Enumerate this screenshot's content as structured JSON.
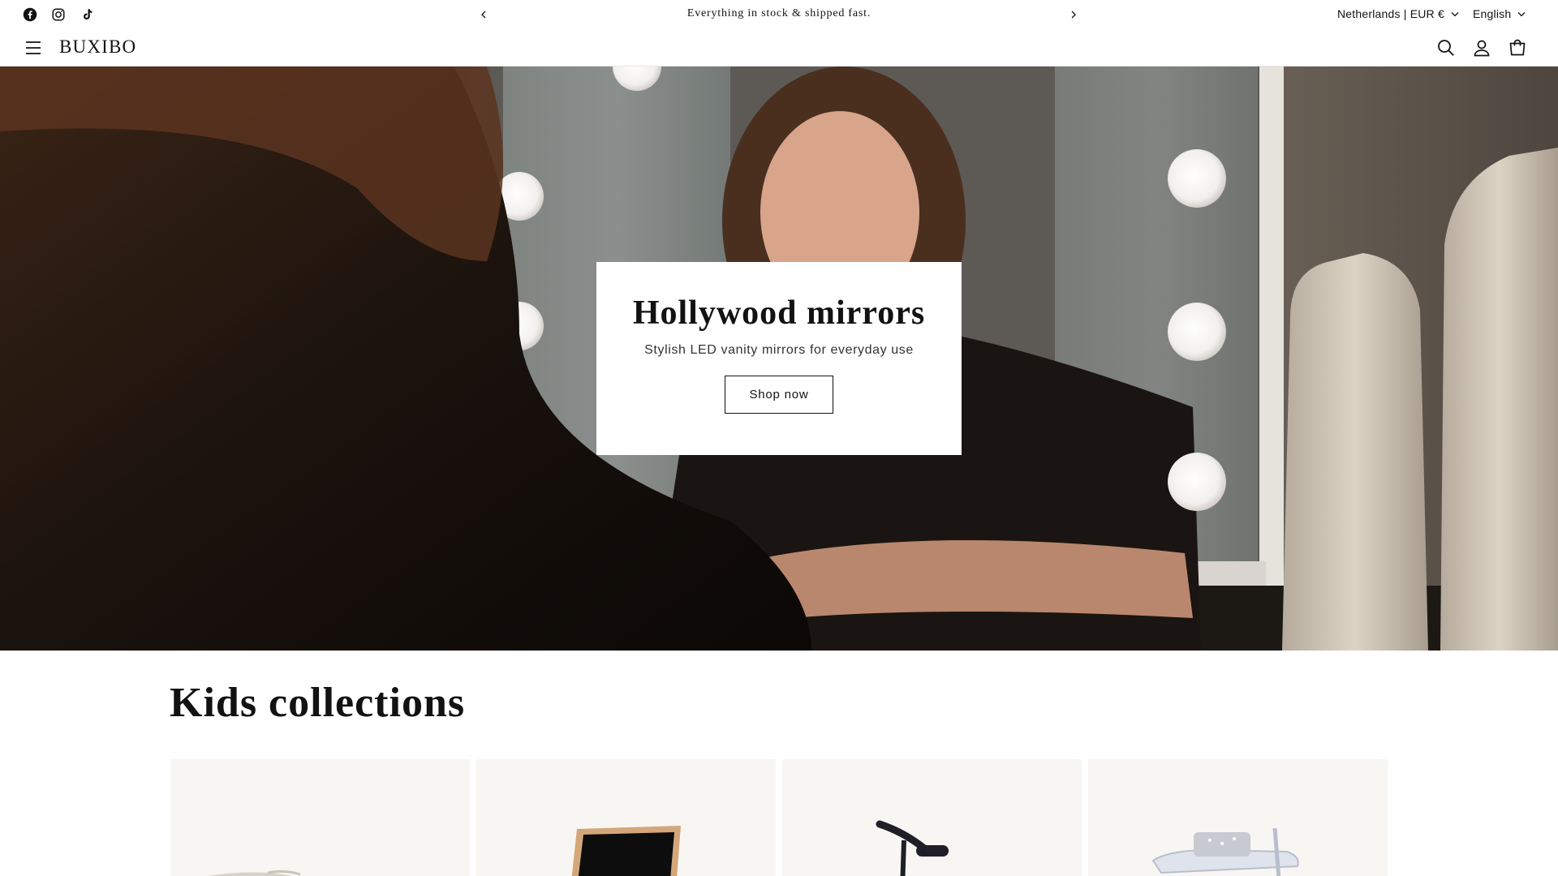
{
  "announcement": {
    "text": "Everything in stock & shipped fast.",
    "prev_icon": "chevron-left-icon",
    "next_icon": "chevron-right-icon"
  },
  "social": [
    {
      "name": "facebook-icon"
    },
    {
      "name": "instagram-icon"
    },
    {
      "name": "tiktok-icon"
    }
  ],
  "localization": {
    "country": "Netherlands | EUR €",
    "language": "English"
  },
  "header": {
    "logo": "BUXIBO",
    "icons": [
      "menu-icon",
      "search-icon",
      "account-icon",
      "cart-icon"
    ]
  },
  "hero": {
    "title": "Hollywood mirrors",
    "subtitle": "Stylish LED vanity mirrors for everyday use",
    "button_label": "Shop now"
  },
  "collections": {
    "title": "Kids collections",
    "cards": [
      {
        "name": "collection-card-1"
      },
      {
        "name": "collection-card-2"
      },
      {
        "name": "collection-card-3"
      },
      {
        "name": "collection-card-4"
      }
    ]
  },
  "colors": {
    "text": "#121212",
    "background": "#ffffff",
    "card_background": "#f8f6f3"
  }
}
